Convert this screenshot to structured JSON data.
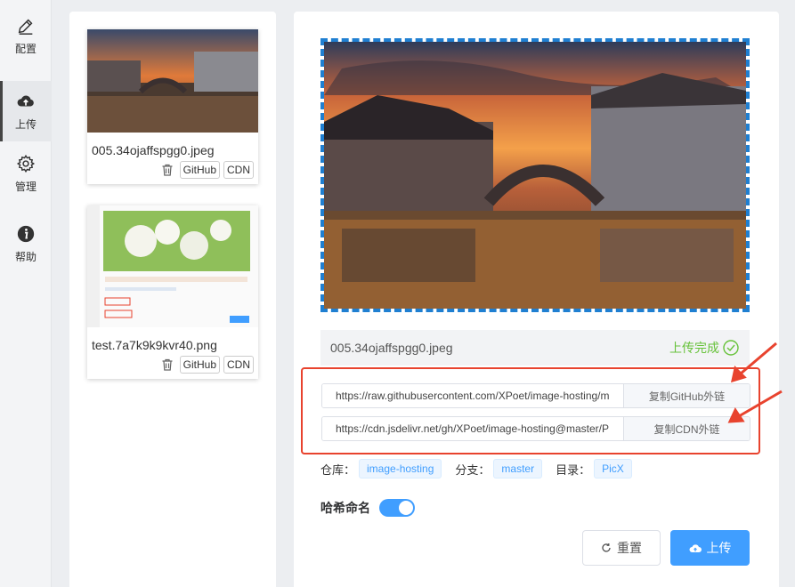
{
  "nav": {
    "items": [
      {
        "label": "配置",
        "icon": "pencil-icon"
      },
      {
        "label": "上传",
        "icon": "cloud-upload-icon",
        "active": true
      },
      {
        "label": "管理",
        "icon": "gear-icon"
      },
      {
        "label": "帮助",
        "icon": "info-icon"
      }
    ]
  },
  "gallery": {
    "cards": [
      {
        "filename": "005.34ojaffspgg0.jpeg",
        "github_label": "GitHub",
        "cdn_label": "CDN"
      },
      {
        "filename": "test.7a7k9k9kvr40.png",
        "github_label": "GitHub",
        "cdn_label": "CDN"
      }
    ]
  },
  "upload": {
    "filename": "005.34ojaffspgg0.jpeg",
    "status": "上传完成",
    "github_url": "https://raw.githubusercontent.com/XPoet/image-hosting/m",
    "github_copy": "复制GitHub外链",
    "cdn_url": "https://cdn.jsdelivr.net/gh/XPoet/image-hosting@master/P",
    "cdn_copy": "复制CDN外链",
    "repo_label": "仓库：",
    "repo_value": "image-hosting",
    "branch_label": "分支：",
    "branch_value": "master",
    "dir_label": "目录：",
    "dir_value": "PicX",
    "hash_label": "哈希命名",
    "hash_enabled": true,
    "reset_label": "重置",
    "upload_label": "上传"
  },
  "colors": {
    "accent": "#409eff",
    "success": "#67c23a",
    "annotation": "#e8432e",
    "dashed_border": "#1f7fd1"
  }
}
